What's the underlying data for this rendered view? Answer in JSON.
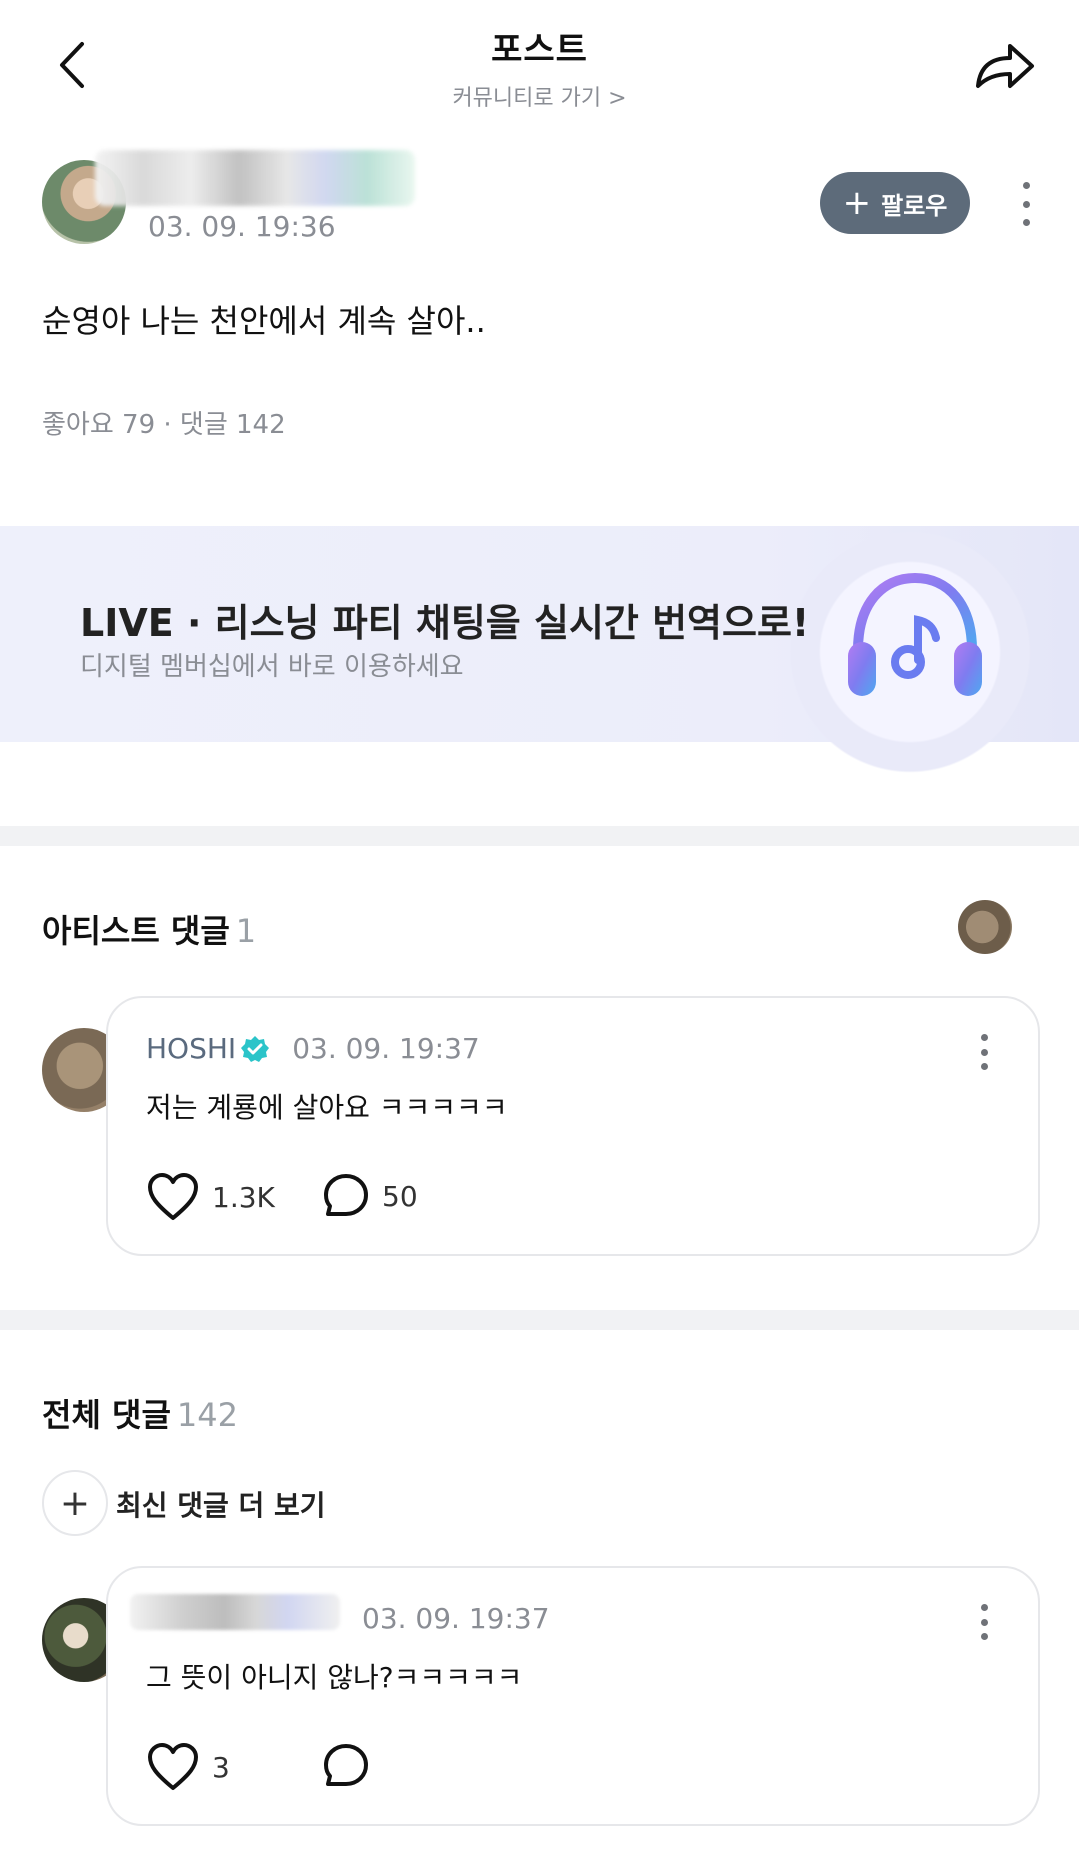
{
  "header": {
    "title": "포스트",
    "subtitle": "커뮤니티로 가기 >"
  },
  "post": {
    "time": "03. 09. 19:36",
    "follow_label": "팔로우",
    "text": "순영아 나는 천안에서 계속 살아..",
    "stats": "좋아요 79  ·  댓글 142"
  },
  "banner": {
    "title": "LIVE · 리스닝 파티 채팅을 실시간 번역으로!",
    "subtitle": "디지털 멤버십에서 바로 이용하세요"
  },
  "artist_comments": {
    "title": "아티스트 댓글",
    "count": "1",
    "items": [
      {
        "name": "HOSHI",
        "verified": true,
        "time": "03. 09. 19:37",
        "text": "저는 계룡에 살아요 ㅋㅋㅋㅋㅋ",
        "likes": "1.3K",
        "replies": "50"
      }
    ]
  },
  "all_comments": {
    "title": "전체 댓글",
    "count": "142",
    "more_label": "최신 댓글 더 보기",
    "items": [
      {
        "time": "03. 09. 19:37",
        "text": "그 뜻이 아니지 않나?ㅋㅋㅋㅋㅋ",
        "likes": "3",
        "replies": ""
      }
    ]
  },
  "colors": {
    "follow_bg": "#5d6b7a",
    "verified": "#2bc4c9",
    "muted": "#8a8d94"
  },
  "icons": [
    "back-arrow-icon",
    "share-icon",
    "plus-icon",
    "more-vertical-icon",
    "headphones-music-icon",
    "verified-badge-icon",
    "heart-icon",
    "comment-bubble-icon"
  ]
}
